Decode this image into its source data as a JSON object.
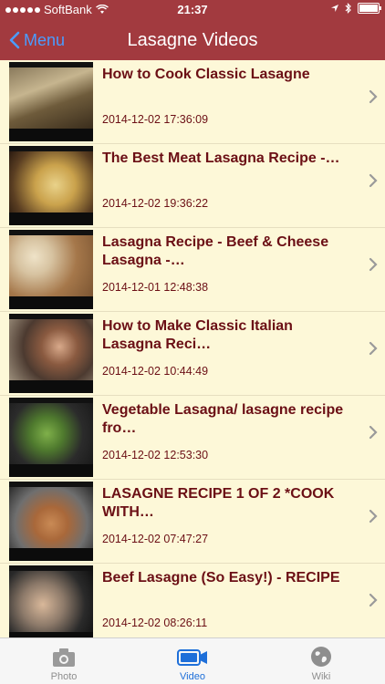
{
  "status_bar": {
    "carrier": "SoftBank",
    "time": "21:37"
  },
  "nav": {
    "back_label": "Menu",
    "title": "Lasagne Videos"
  },
  "videos": [
    {
      "title": "How to Cook Classic Lasagne",
      "date": "2014-12-02 17:36:09"
    },
    {
      "title": "The Best Meat Lasagna Recipe -…",
      "date": "2014-12-02 19:36:22"
    },
    {
      "title": "Lasagna Recipe - Beef & Cheese Lasagna -…",
      "date": "2014-12-01 12:48:38"
    },
    {
      "title": "How to Make Classic Italian Lasagna Reci…",
      "date": "2014-12-02 10:44:49"
    },
    {
      "title": "Vegetable Lasagna/ lasagne recipe fro…",
      "date": "2014-12-02 12:53:30"
    },
    {
      "title": "LASAGNE RECIPE 1 OF 2 *COOK WITH…",
      "date": "2014-12-02 07:47:27"
    },
    {
      "title": "Beef Lasagne (So Easy!) - RECIPE",
      "date": "2014-12-02 08:26:11"
    }
  ],
  "tabs": [
    {
      "label": "Photo",
      "icon": "camera-icon",
      "active": false
    },
    {
      "label": "Video",
      "icon": "video-camera-icon",
      "active": true
    },
    {
      "label": "Wiki",
      "icon": "globe-icon",
      "active": false
    }
  ],
  "colors": {
    "bar": "#a23a3f",
    "row_text": "#6b0f15",
    "list_bg": "#fdf8d8",
    "active_tab": "#1e6fd9",
    "inactive_tab": "#8e8e8e"
  }
}
